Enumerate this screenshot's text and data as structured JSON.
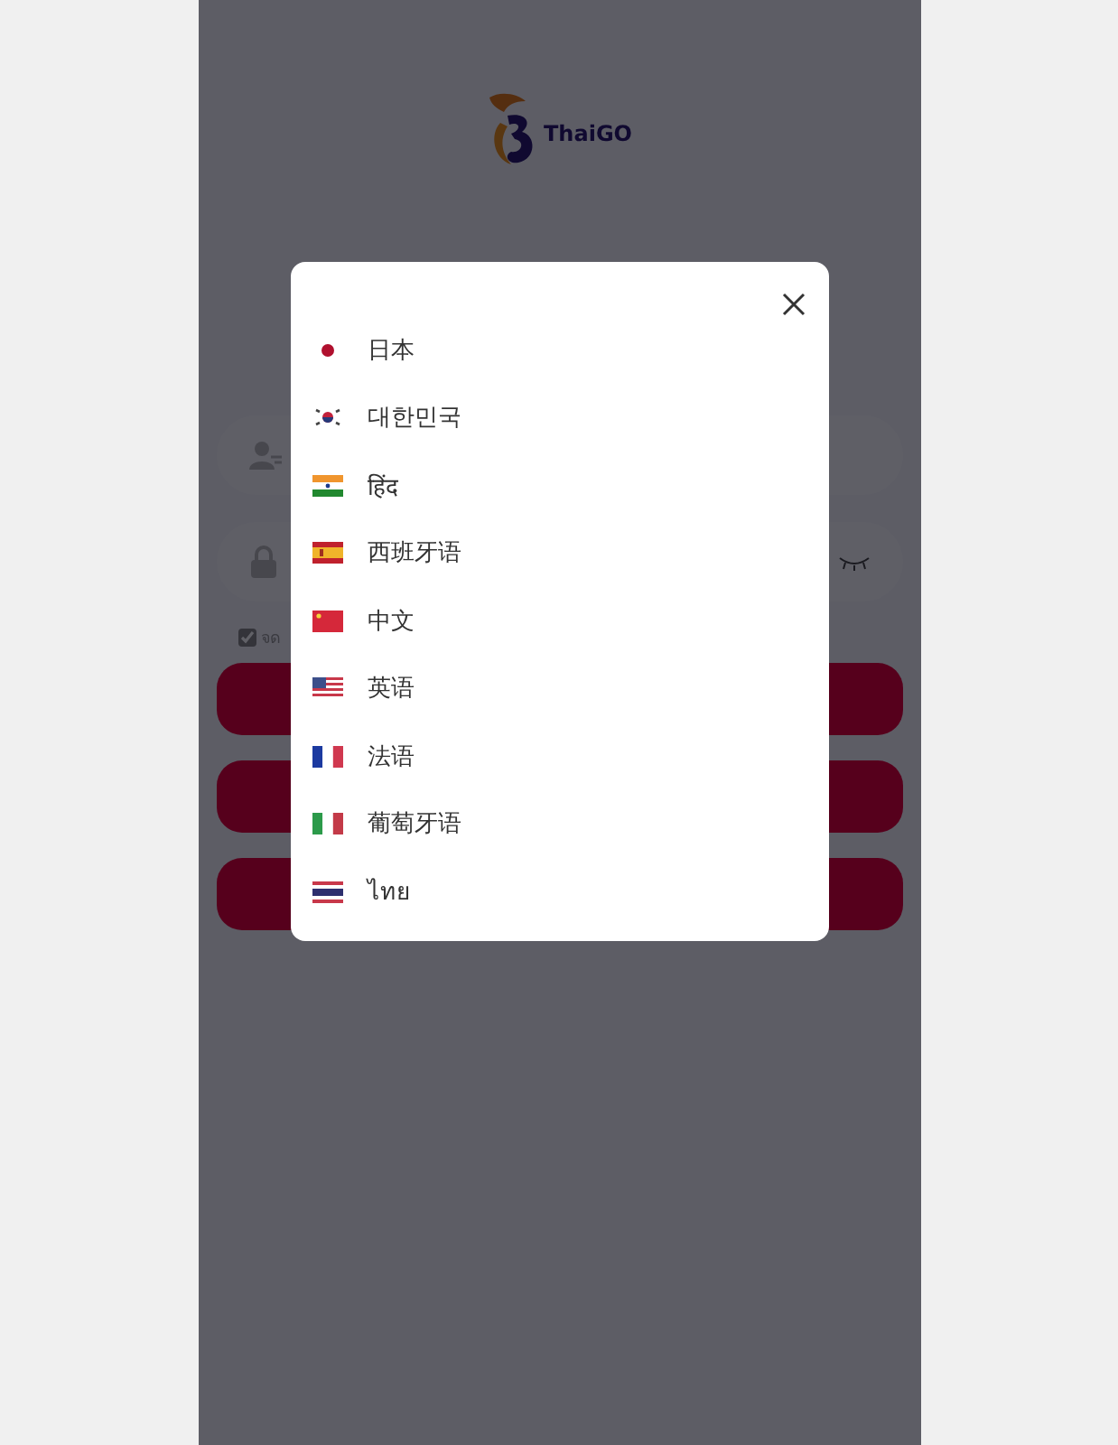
{
  "logo": {
    "text": "ThaiGO"
  },
  "login": {
    "fields": [
      {
        "kind": "user"
      },
      {
        "kind": "password"
      }
    ],
    "remember": {
      "checked": true,
      "label": "จด"
    }
  },
  "dialog": {
    "languages": [
      {
        "label": "日本",
        "kind": "jp"
      },
      {
        "label": "대한민국",
        "kind": "kr"
      },
      {
        "label": "हिंद",
        "kind": "in"
      },
      {
        "label": "西班牙语",
        "kind": "es"
      },
      {
        "label": "中文",
        "kind": "cn"
      },
      {
        "label": "英语",
        "kind": "us"
      },
      {
        "label": "法语",
        "kind": "fr"
      },
      {
        "label": "葡萄牙语",
        "kind": "it"
      },
      {
        "label": "ไทย",
        "kind": "th"
      }
    ]
  }
}
